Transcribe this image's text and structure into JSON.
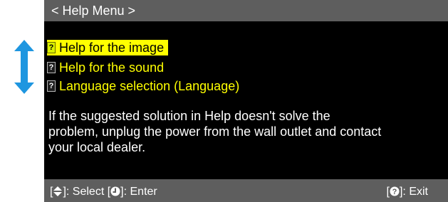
{
  "help_menu": {
    "title": "< Help Menu >",
    "items": [
      {
        "label": "Help for the image",
        "selected": true
      },
      {
        "label": "Help for the sound",
        "selected": false
      },
      {
        "label": "Language selection (Language)",
        "selected": false
      }
    ],
    "item_icon": "question-mark-icon",
    "message_lines": [
      "If the suggested solution in Help doesn't solve the",
      "problem, unplug the power from the wall outlet and contact",
      "your local dealer."
    ]
  },
  "footer": {
    "select_prefix": "[",
    "select_suffix": "]: Select",
    "enter_prefix": "[",
    "enter_suffix": "]: Enter",
    "exit_prefix": "[",
    "exit_suffix": "]: Exit"
  },
  "colors": {
    "highlight": "#ffff00",
    "title_bar": "#5e5e5e",
    "arrow": "#1e96e0",
    "panel": "#000000"
  },
  "icons": {
    "side_arrow": "up-down-arrow-icon",
    "select_key": "up-down-key-icon",
    "enter_key": "enter-key-icon",
    "exit_key": "help-key-icon"
  }
}
